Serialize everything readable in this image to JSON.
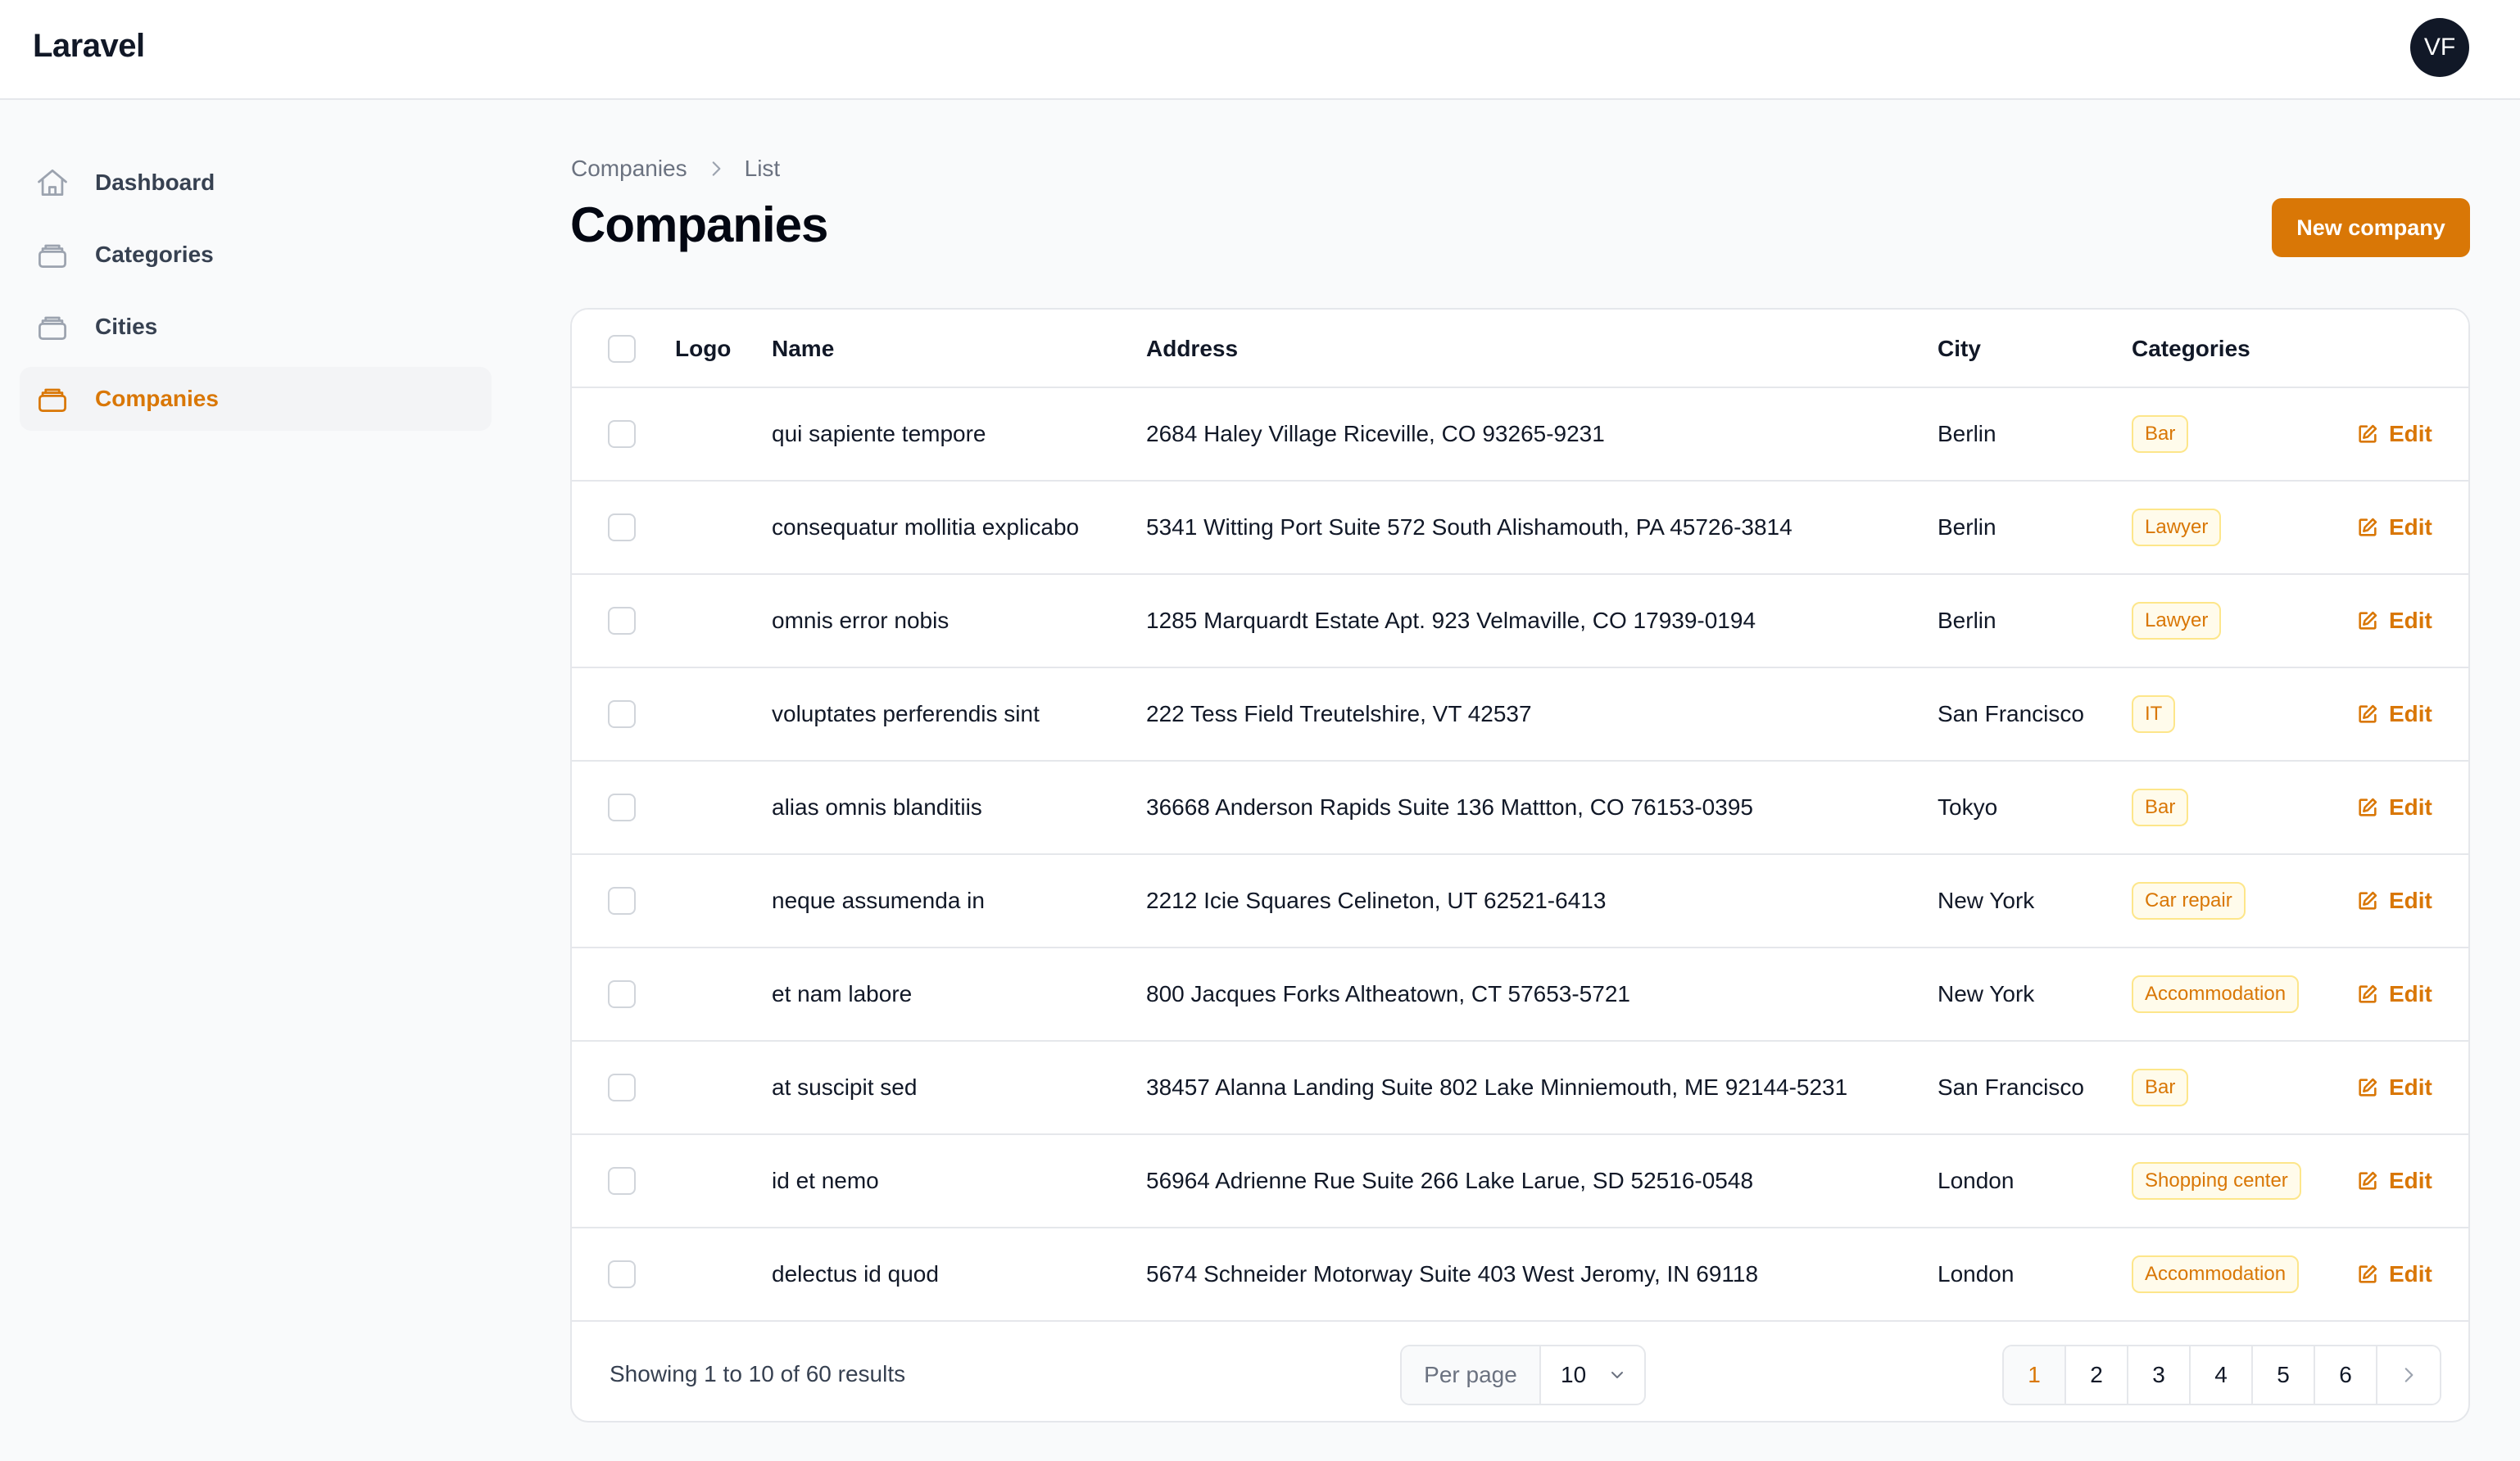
{
  "app": {
    "brand": "Laravel",
    "avatar_initials": "VF"
  },
  "sidebar": {
    "items": [
      {
        "label": "Dashboard",
        "icon": "home-icon",
        "active": false
      },
      {
        "label": "Categories",
        "icon": "stack-icon",
        "active": false
      },
      {
        "label": "Cities",
        "icon": "stack-icon",
        "active": false
      },
      {
        "label": "Companies",
        "icon": "stack-icon",
        "active": true
      }
    ]
  },
  "breadcrumb": {
    "parent": "Companies",
    "current": "List"
  },
  "page": {
    "title": "Companies",
    "new_button": "New company"
  },
  "table": {
    "headers": {
      "logo": "Logo",
      "name": "Name",
      "address": "Address",
      "city": "City",
      "categories": "Categories"
    },
    "edit_label": "Edit",
    "rows": [
      {
        "name": "qui sapiente tempore",
        "address": "2684 Haley Village Riceville, CO 93265-9231",
        "city": "Berlin",
        "category": "Bar"
      },
      {
        "name": "consequatur mollitia explicabo",
        "address": "5341 Witting Port Suite 572 South Alishamouth, PA 45726-3814",
        "city": "Berlin",
        "category": "Lawyer"
      },
      {
        "name": "omnis error nobis",
        "address": "1285 Marquardt Estate Apt. 923 Velmaville, CO 17939-0194",
        "city": "Berlin",
        "category": "Lawyer"
      },
      {
        "name": "voluptates perferendis sint",
        "address": "222 Tess Field Treutelshire, VT 42537",
        "city": "San Francisco",
        "category": "IT"
      },
      {
        "name": "alias omnis blanditiis",
        "address": "36668 Anderson Rapids Suite 136 Mattton, CO 76153-0395",
        "city": "Tokyo",
        "category": "Bar"
      },
      {
        "name": "neque assumenda in",
        "address": "2212 Icie Squares Celineton, UT 62521-6413",
        "city": "New York",
        "category": "Car repair"
      },
      {
        "name": "et nam labore",
        "address": "800 Jacques Forks Altheatown, CT 57653-5721",
        "city": "New York",
        "category": "Accommodation"
      },
      {
        "name": "at suscipit sed",
        "address": "38457 Alanna Landing Suite 802 Lake Minniemouth, ME 92144-5231",
        "city": "San Francisco",
        "category": "Bar"
      },
      {
        "name": "id et nemo",
        "address": "56964 Adrienne Rue Suite 266 Lake Larue, SD 52516-0548",
        "city": "London",
        "category": "Shopping center"
      },
      {
        "name": "delectus id quod",
        "address": "5674 Schneider Motorway Suite 403 West Jeromy, IN 69118",
        "city": "London",
        "category": "Accommodation"
      }
    ]
  },
  "pagination": {
    "summary": "Showing 1 to 10 of 60 results",
    "per_page_label": "Per page",
    "per_page_value": "10",
    "pages": [
      "1",
      "2",
      "3",
      "4",
      "5",
      "6"
    ],
    "current_page": "1"
  },
  "colors": {
    "accent": "#d97706",
    "border": "#e5e7eb",
    "text": "#111827"
  }
}
